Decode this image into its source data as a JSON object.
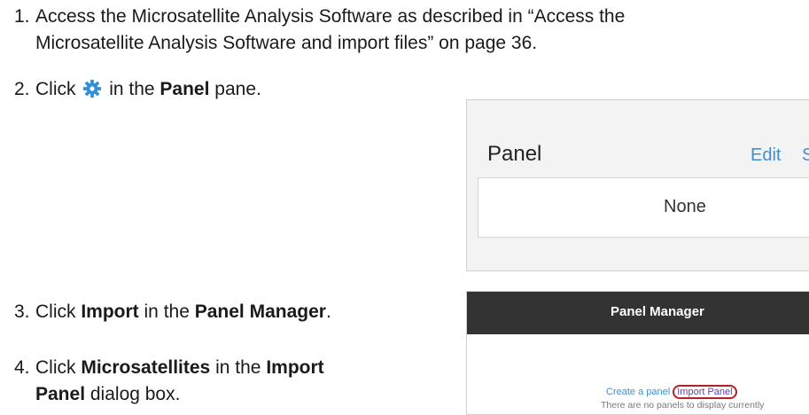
{
  "steps": [
    {
      "number": "1.",
      "line1": "Access the Microsatellite Analysis Software as described in “Access the",
      "line2": "Microsatellite Analysis Software and import files” on page 36."
    },
    {
      "number": "2.",
      "pre": "Click",
      "icon": "gear-icon",
      "mid": "in the",
      "bold": "Panel",
      "post": "pane."
    },
    {
      "number": "3.",
      "pre": "Click",
      "bold1": "Import",
      "mid": "in the",
      "bold2": "Panel Manager",
      "post": "."
    },
    {
      "number": "4.",
      "pre": "Click",
      "bold1": "Microsatellites",
      "mid": "in the",
      "bold2a": "Import",
      "bold2b": "Panel",
      "post": "dialog box."
    }
  ],
  "panel_pane": {
    "title": "Panel",
    "edit_label": "Edit",
    "clipped_label": "S",
    "value": "None"
  },
  "panel_manager": {
    "title": "Panel Manager",
    "create_link": "Create a panel",
    "import_link": "Import Panel",
    "empty_message": "There are no panels to display currently"
  },
  "colors": {
    "gear_icon": "#2f8fd8",
    "link": "#3f8fd0",
    "highlight_circle": "#b3202a",
    "header_bg": "#333333"
  }
}
